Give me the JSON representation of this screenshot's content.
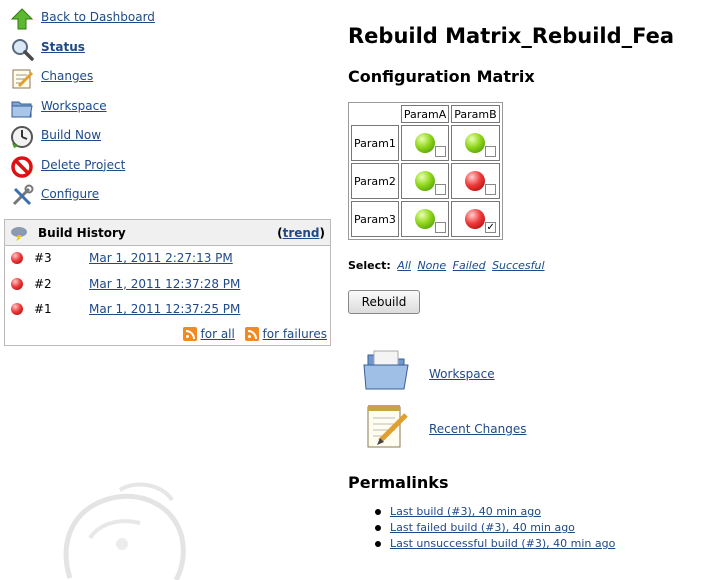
{
  "sidebar": {
    "items": [
      {
        "label": "Back to Dashboard",
        "icon": "up-arrow-icon"
      },
      {
        "label": "Status",
        "icon": "magnifier-icon"
      },
      {
        "label": "Changes",
        "icon": "notepad-icon"
      },
      {
        "label": "Workspace",
        "icon": "folder-icon"
      },
      {
        "label": "Build Now",
        "icon": "clock-icon"
      },
      {
        "label": "Delete Project",
        "icon": "no-entry-icon"
      },
      {
        "label": "Configure",
        "icon": "tools-icon"
      }
    ]
  },
  "build_history": {
    "title": "Build History",
    "trend_open": "(",
    "trend_label": "trend",
    "trend_close": ")",
    "builds": [
      {
        "number": "#3",
        "date": "Mar 1, 2011 2:27:13 PM",
        "status": "failed"
      },
      {
        "number": "#2",
        "date": "Mar 1, 2011 12:37:28 PM",
        "status": "failed"
      },
      {
        "number": "#1",
        "date": "Mar 1, 2011 12:37:25 PM",
        "status": "failed"
      }
    ],
    "rss_all": "for all",
    "rss_failures": "for failures"
  },
  "main": {
    "title": "Rebuild Matrix_Rebuild_Fea",
    "matrix_heading": "Configuration Matrix",
    "matrix": {
      "columns": [
        "ParamA",
        "ParamB"
      ],
      "rows": [
        {
          "label": "Param1",
          "cells": [
            {
              "status": "success",
              "checked": false
            },
            {
              "status": "success",
              "checked": false
            }
          ]
        },
        {
          "label": "Param2",
          "cells": [
            {
              "status": "success",
              "checked": false
            },
            {
              "status": "failed",
              "checked": false
            }
          ]
        },
        {
          "label": "Param3",
          "cells": [
            {
              "status": "success",
              "checked": false
            },
            {
              "status": "failed",
              "checked": true
            }
          ]
        }
      ]
    },
    "select": {
      "label": "Select:",
      "all": "All",
      "none": "None",
      "failed": "Failed",
      "successful": "Succesful"
    },
    "rebuild_button": "Rebuild",
    "workspace_link": "Workspace",
    "recent_changes_link": "Recent Changes",
    "permalinks_heading": "Permalinks",
    "permalinks": [
      "Last build (#3), 40 min ago",
      "Last failed build (#3), 40 min ago",
      "Last unsuccessful build (#3), 40 min ago"
    ]
  },
  "colors": {
    "link": "#204a87",
    "visited": "#5c3566",
    "success": "#8fd61b",
    "failed": "#ee3a3a"
  }
}
